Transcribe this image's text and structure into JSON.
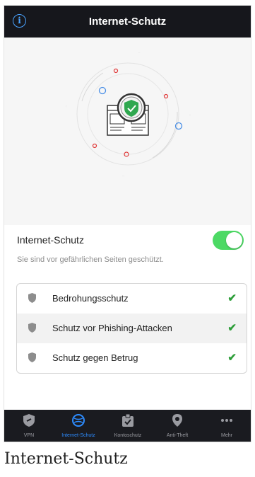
{
  "topbar": {
    "title": "Internet-Schutz",
    "info_icon": "info-icon"
  },
  "hero": {
    "illustration_icon": "protected-browser-shield-illustration"
  },
  "protection": {
    "label": "Internet-Schutz",
    "enabled": true,
    "status_text": "Sie sind vor gefährlichen Seiten geschützt."
  },
  "features": [
    {
      "label": "Bedrohungsschutz",
      "icon": "shield-icon",
      "checked": true
    },
    {
      "label": "Schutz vor Phishing-Attacken",
      "icon": "shield-icon",
      "checked": true
    },
    {
      "label": "Schutz gegen Betrug",
      "icon": "shield-icon",
      "checked": true
    }
  ],
  "tabs": [
    {
      "label": "VPN",
      "icon": "vpn-shield-icon",
      "active": false
    },
    {
      "label": "Internet-Schutz",
      "icon": "globe-icon",
      "active": true
    },
    {
      "label": "Kontoschutz",
      "icon": "account-clipboard-icon",
      "active": false
    },
    {
      "label": "Anti-Theft",
      "icon": "location-pin-icon",
      "active": false
    },
    {
      "label": "Mehr",
      "icon": "more-dots-icon",
      "active": false
    }
  ],
  "caption": "Internet-Schutz",
  "colors": {
    "accent": "#2d8cff",
    "toggle_on": "#4cd964",
    "check": "#2e9e3a",
    "bar": "#16171c"
  }
}
